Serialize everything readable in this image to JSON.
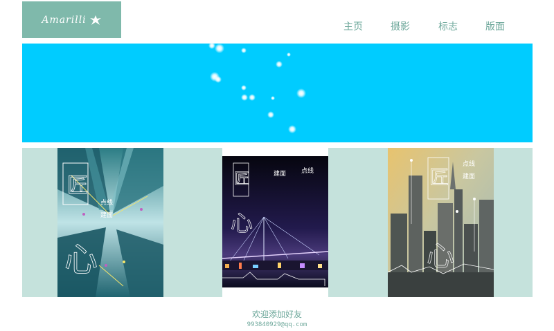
{
  "header": {
    "logo_text": "Amarilli",
    "nav": [
      {
        "label": "主页"
      },
      {
        "label": "摄影"
      },
      {
        "label": "标志"
      },
      {
        "label": "版面"
      }
    ]
  },
  "colors": {
    "logo_bg": "#7fb9ab",
    "banner_bg": "#00ccff",
    "gallery_bg": "#c5e2dc",
    "accent_text": "#6ea89b"
  },
  "gallery": {
    "posters": [
      {
        "title_chars": [
          "匠",
          "心"
        ],
        "tagline_top": "点线",
        "tagline_bottom": "建面",
        "scene": "city-up"
      },
      {
        "title_chars": [
          "匠",
          "心"
        ],
        "tagline_top": "点线",
        "tagline_bottom": "建面",
        "scene": "bridge-night"
      },
      {
        "title_chars": [
          "匠",
          "心"
        ],
        "tagline_top": "点线",
        "tagline_bottom": "建面",
        "scene": "skyline-sunset"
      }
    ]
  },
  "footer": {
    "title": "欢迎添加好友",
    "email": "993840929@qq.com"
  }
}
